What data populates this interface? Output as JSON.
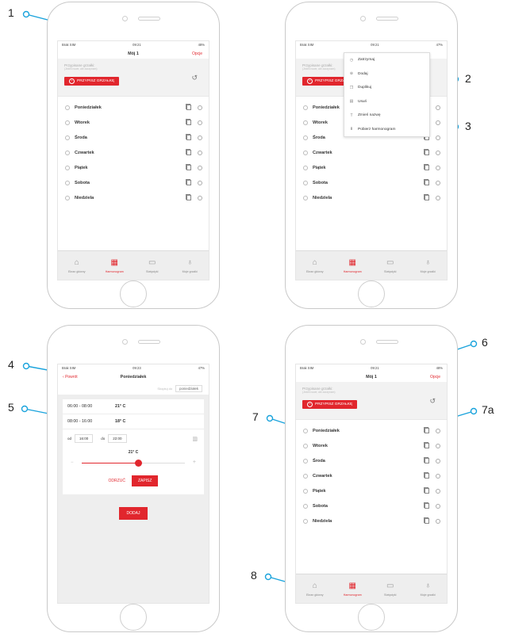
{
  "status": {
    "carrier": "Brak SIM",
    "time_a": "09:21",
    "time_b": "09:23",
    "battery_a": "48%",
    "battery_b": "47%"
  },
  "schedule": {
    "title": "Mój 1",
    "options": "Opcje",
    "hint": "Przypisane grzałki:",
    "hint_small": "(Jeżeli nowe, ale zaczynam)",
    "assign_button": "PRZYPISZ GRZAŁKĘ",
    "days": [
      "Poniedziałek",
      "Wtorek",
      "Środa",
      "Czwartek",
      "Piątek",
      "Sobota",
      "Niedziela"
    ]
  },
  "menu": {
    "items": [
      "Zatrzymaj",
      "Dodaj",
      "Duplikuj",
      "Usuń",
      "Zmień nazwę",
      "Pobierz harmonogram"
    ]
  },
  "tabs": [
    "Ekran główny",
    "Harmonogram",
    "Statystyki",
    "Moje grzałki"
  ],
  "editor": {
    "back": "Powrót",
    "title": "Poniedziałek",
    "copy_label": "Skopiuj do",
    "copy_value": "poniedziałek",
    "intervals": [
      {
        "time": "06:00 - 08:00",
        "temp": "21° C"
      },
      {
        "time": "08:00 - 16:00",
        "temp": "18° C"
      }
    ],
    "from_label": "od",
    "from_value": "16:00",
    "to_label": "do",
    "to_value": "22:00",
    "temp_value": "21° C",
    "slider_level": 0.55,
    "discard": "ODRZUĆ",
    "save": "ZAPISZ",
    "add": "DODAJ"
  },
  "callouts": {
    "c1": "1",
    "c2": "2",
    "c3": "3",
    "c4": "4",
    "c5": "5",
    "c6": "6",
    "c7": "7",
    "c7a": "7a",
    "c8": "8"
  },
  "colors": {
    "accent": "#e1262d",
    "callout": "#1aa3dc"
  }
}
